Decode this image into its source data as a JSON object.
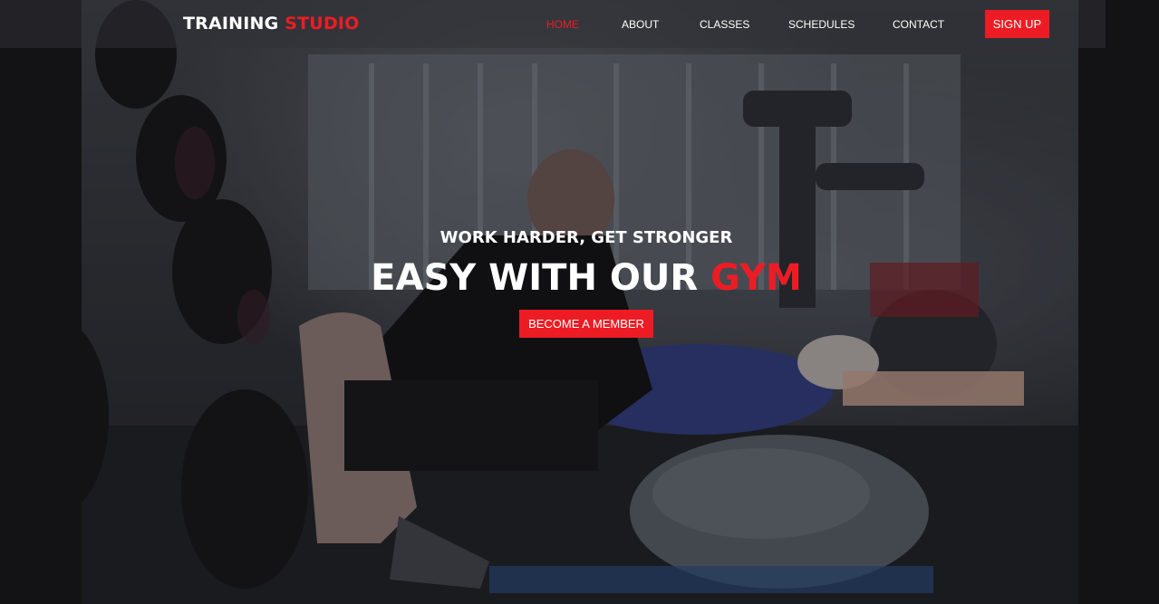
{
  "brand": {
    "name": "TRAINING",
    "name_accent": "STUDIO"
  },
  "nav": {
    "items": [
      {
        "label": "HOME",
        "active": true
      },
      {
        "label": "ABOUT",
        "active": false
      },
      {
        "label": "CLASSES",
        "active": false
      },
      {
        "label": "SCHEDULES",
        "active": false
      },
      {
        "label": "CONTACT",
        "active": false
      }
    ],
    "signup_label": "SIGN UP"
  },
  "hero": {
    "subtitle": "WORK HARDER, GET STRONGER",
    "title": "EASY WITH OUR",
    "title_accent": "GYM",
    "cta_label": "BECOME A MEMBER"
  },
  "colors": {
    "accent": "#ed1c24",
    "text": "#ffffff",
    "header_bg": "rgba(50,50,54,0.55)"
  }
}
